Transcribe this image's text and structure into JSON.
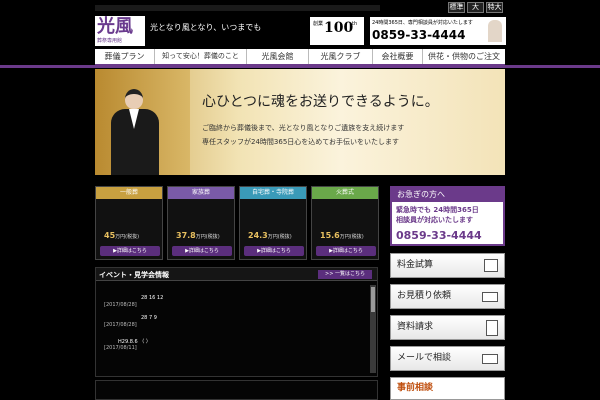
{
  "font_size": {
    "standard": "標準",
    "large": "大",
    "xlarge": "特大"
  },
  "logo": {
    "kanji": "光風",
    "subtitle": "葬祭専用館",
    "slogan": "光となり風となり、いつまでも"
  },
  "badge": {
    "prefix": "創業",
    "number": "100",
    "suffix": "th"
  },
  "phone_header": {
    "note": "24時間365日、専門相談員が対応いたします",
    "number": "0859-33-4444"
  },
  "nav": [
    "葬儀プラン",
    "知って安心！葬儀のこと",
    "光風会館",
    "光風クラブ",
    "会社概要",
    "供花・供物のご注文"
  ],
  "hero": {
    "title": "心ひとつに魂をお送りできるように。",
    "line1": "ご臨終から葬儀後まで、光となり風となりご遺族を支え続けます",
    "line2": "専任スタッフが24時間365日心を込めてお手伝いをいたします"
  },
  "plans": [
    {
      "name": "一般葬",
      "price": "45",
      "unit": "万円",
      "tax": "(税抜)",
      "button": "▶詳細はこちら",
      "color": "#c8a040"
    },
    {
      "name": "家族葬",
      "price": "37.8",
      "unit": "万円",
      "tax": "(税抜)",
      "button": "▶詳細はこちら",
      "color": "#7a5aa8"
    },
    {
      "name": "自宅葬・寺院葬",
      "price": "24.3",
      "unit": "万円",
      "tax": "(税抜)",
      "button": "▶詳細はこちら",
      "color": "#3a9ab8"
    },
    {
      "name": "火葬式",
      "price": "15.6",
      "unit": "万円",
      "tax": "(税抜)",
      "button": "▶詳細はこちら",
      "color": "#6aa84a"
    }
  ],
  "events": {
    "title": "イベント・見学会情報",
    "more": ">> 一覧はこちら",
    "items": [
      {
        "text": "28 16 12",
        "date": "[2017/08/28]"
      },
      {
        "text": "28 7 9",
        "date": "[2017/08/28]"
      },
      {
        "text": "H29.8.6 （ ）",
        "date": "[2017/08/11]"
      }
    ]
  },
  "urgent": {
    "title": "お急ぎの方へ",
    "line1": "緊急時でも 24時間365日",
    "line2": "相談員が対応いたします",
    "phone": "0859-33-4444"
  },
  "side_buttons": [
    "料金試算",
    "お見積り依頼",
    "資料請求",
    "メールで相談"
  ],
  "consult": "事前相談"
}
